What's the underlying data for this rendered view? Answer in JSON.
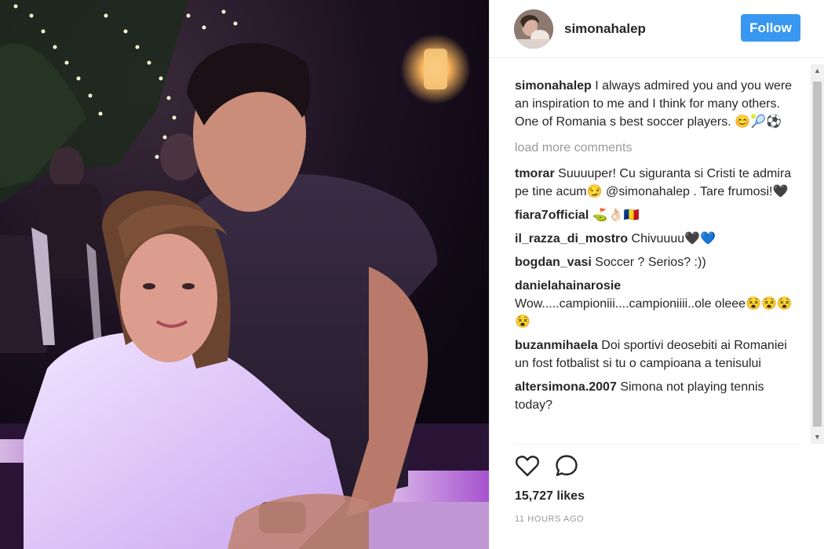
{
  "post": {
    "username": "simonahalep",
    "follow_label": "Follow",
    "caption": {
      "user": "simonahalep",
      "text": "I always admired you and you were an inspiration to me and I think for many others. One of Romania s best soccer players. 😊🎾⚽"
    },
    "load_more_label": "load more comments",
    "comments": [
      {
        "user": "tmorar",
        "text": "Suuuuper! Cu siguranta si Cristi te admira pe tine acum😏 @simonahalep . Tare frumosi!🖤"
      },
      {
        "user": "fiara7official",
        "text": "⛳👌🏻🇷🇴"
      },
      {
        "user": "il_razza_di_mostro",
        "text": "Chivuuuu🖤💙"
      },
      {
        "user": "bogdan_vasi",
        "text": "Soccer ? Serios? :))"
      },
      {
        "user": "danielahainarosie",
        "text": "Wow.....campioniii....campioniiii..ole oleee😵😵😵😵"
      },
      {
        "user": "buzanmihaela",
        "text": "Doi sportivi deosebiti ai Romaniei un fost fotbalist si tu o campioana a tenisului"
      },
      {
        "user": "altersimona.2007",
        "text": "Simona not playing tennis today?"
      }
    ],
    "likes_label": "15,727 likes",
    "timestamp": "11 HOURS AGO",
    "icons": {
      "like": "heart-icon",
      "comment": "comment-icon",
      "scroll_up": "chevron-up-icon",
      "scroll_down": "chevron-down-icon"
    },
    "colors": {
      "follow_button": "#3897f0",
      "muted_text": "#999999",
      "text": "#262626"
    }
  }
}
